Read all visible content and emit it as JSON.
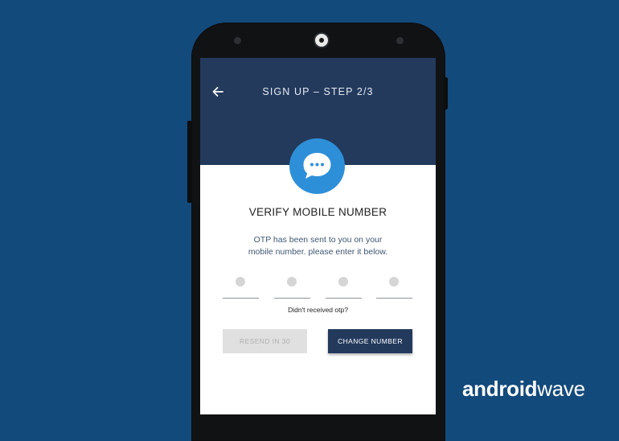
{
  "header": {
    "title": "SIGN UP – STEP 2/3"
  },
  "verify": {
    "title": "VERIFY MOBILE NUMBER",
    "description_line1": "OTP has been sent to you on your",
    "description_line2": "mobile number. please enter it below."
  },
  "otp": {
    "slots": 4,
    "resend_question": "Didn't received otp?"
  },
  "buttons": {
    "resend_label": "RESEND IN 30",
    "change_number_label": "CHANGE NUMBER"
  },
  "watermark": {
    "part1": "android",
    "part2": "wave"
  },
  "colors": {
    "background": "#134a7c",
    "header": "#233a5d",
    "accent_blue": "#2e8fd9",
    "disabled_button": "#e0e0e0"
  },
  "icons": {
    "back": "back-arrow-icon",
    "chat": "chat-bubble-icon"
  }
}
